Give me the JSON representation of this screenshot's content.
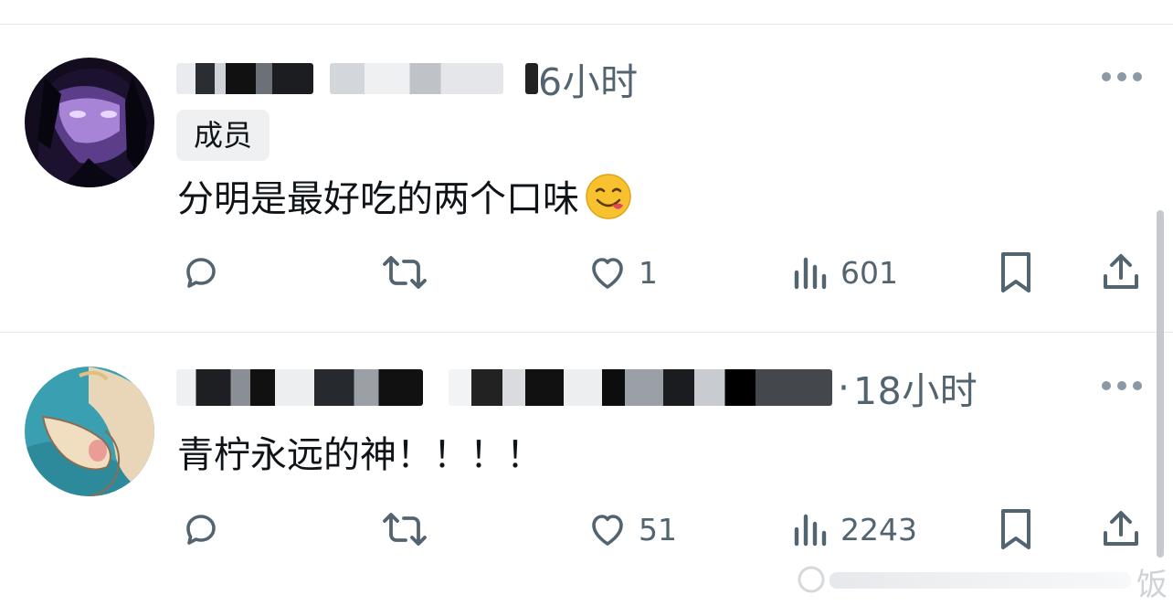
{
  "posts": [
    {
      "time": "6小时",
      "badge": "成员",
      "text": "分明是最好吃的两个口味",
      "emoji": "yum-face-emoji",
      "actions": {
        "reply": "",
        "repost": "",
        "like": "1",
        "views": "601"
      }
    },
    {
      "time": "18小时",
      "separator": "·",
      "text": "青柠永远的神！！！！",
      "actions": {
        "reply": "",
        "repost": "",
        "like": "51",
        "views": "2243"
      }
    }
  ],
  "watermark": {
    "text": "饭"
  },
  "colors": {
    "icon": "#536471",
    "text": "#0f1419",
    "divider": "#e6e9ec"
  },
  "icons": [
    "reply-icon",
    "repost-icon",
    "like-icon",
    "views-icon",
    "bookmark-icon",
    "share-icon",
    "more-icon"
  ]
}
